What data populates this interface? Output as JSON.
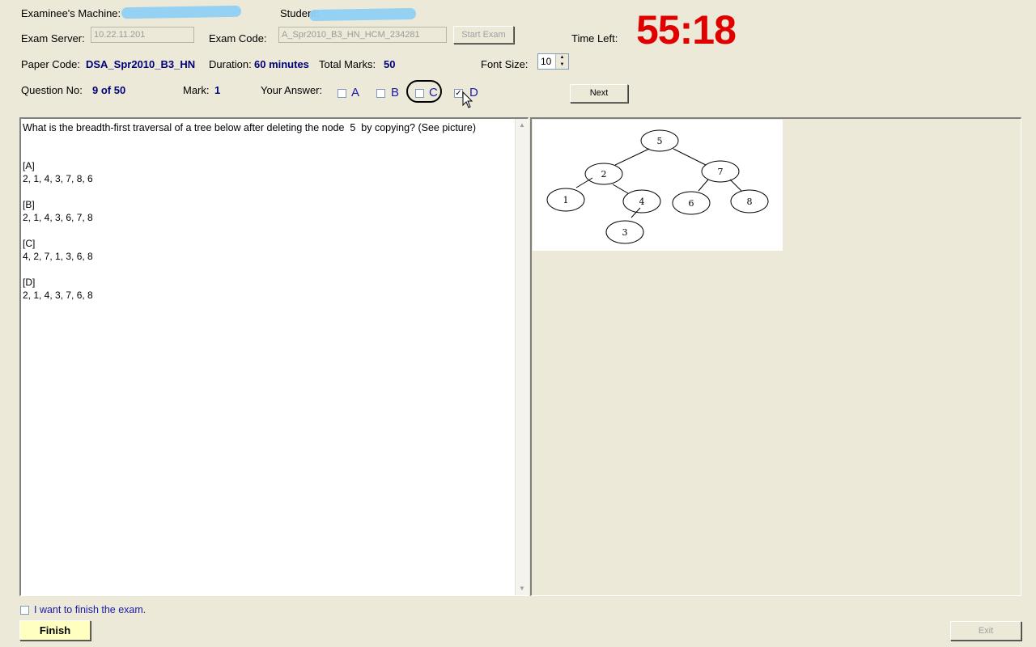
{
  "header": {
    "examinee_machine_label": "Examinee's Machine:",
    "student_label": "Student:",
    "exam_server_label": "Exam Server:",
    "exam_server_value": "10.22.11.201",
    "exam_code_label": "Exam Code:",
    "exam_code_value": "A_Spr2010_B3_HN_HCM_234281",
    "start_exam_label": "Start Exam",
    "time_left_label": "Time Left:",
    "time_left_value": "55:18",
    "paper_code_label": "Paper Code:",
    "paper_code_value": "DSA_Spr2010_B3_HN",
    "duration_label": "Duration:",
    "duration_value": "60 minutes",
    "total_marks_label": "Total Marks:",
    "total_marks_value": "50",
    "font_size_label": "Font Size:",
    "font_size_value": "10",
    "question_no_label": "Question No:",
    "question_no_value": "9 of 50",
    "mark_label": "Mark:",
    "mark_value": "1",
    "your_answer_label": "Your Answer:",
    "next_label": "Next"
  },
  "answers": [
    {
      "label": "A",
      "checked": false
    },
    {
      "label": "B",
      "checked": false
    },
    {
      "label": "C",
      "checked": false
    },
    {
      "label": "D",
      "checked": true
    }
  ],
  "question": {
    "text": "What is the breadth-first traversal of a tree below after deleting the node  5  by copying? (See picture)",
    "options": [
      {
        "tag": "[A]",
        "value": "2, 1, 4, 3, 7, 8, 6"
      },
      {
        "tag": "[B]",
        "value": "2, 1, 4, 3, 6, 7, 8"
      },
      {
        "tag": "[C]",
        "value": "4, 2, 7, 1, 3, 6, 8"
      },
      {
        "tag": "[D]",
        "value": "2, 1, 4, 3, 7, 6, 8"
      }
    ]
  },
  "tree_nodes": [
    "5",
    "2",
    "7",
    "1",
    "4",
    "6",
    "8",
    "3"
  ],
  "footer": {
    "finish_checkbox_label": "I want to finish the exam.",
    "finish_label": "Finish",
    "exit_label": "Exit"
  },
  "colors": {
    "background": "#ece9d8",
    "timer": "#e00000",
    "value_blue": "#00007a",
    "finish_button": "#ffffc0"
  }
}
